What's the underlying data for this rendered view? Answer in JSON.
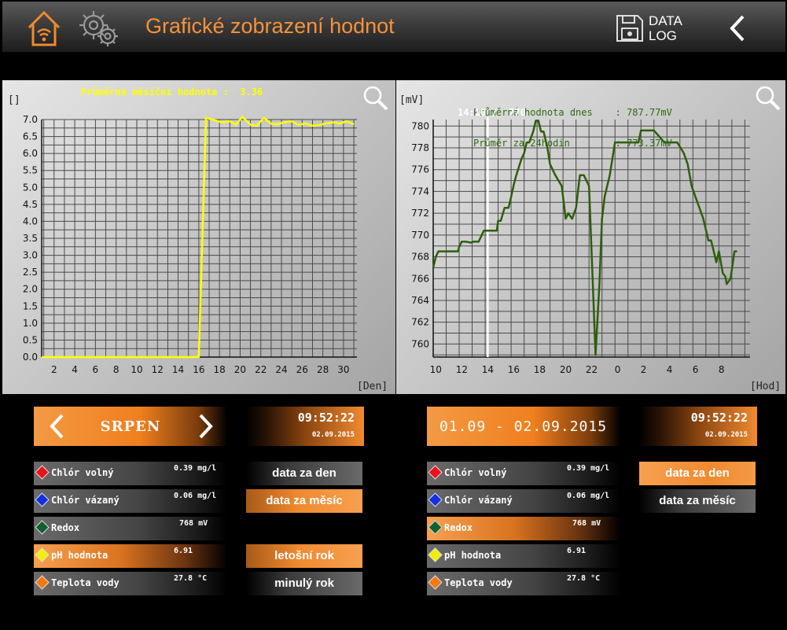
{
  "header": {
    "title": "Grafické zobrazení hodnot",
    "datalog_line1": "DATA",
    "datalog_line2": "LOG",
    "icons": [
      "home-wifi-icon",
      "gear-icon",
      "floppy-disk-icon",
      "back-arrow-icon"
    ]
  },
  "left_panel": {
    "unit": "[]",
    "x_unit": "[Den]",
    "info": "Průměrná měsíční hodnota :  3.36",
    "info_color": "#ffff00"
  },
  "right_panel": {
    "unit": "[mV]",
    "x_unit": "[Hod]",
    "info_line1": "Průměrná hodnota dnes    : 787.77mV",
    "info_line2": "Průměr za 24hodin        : 773.37mV",
    "info_color": "#2e6a10",
    "cursor_label": "14:10 /  770"
  },
  "chart_data": [
    {
      "type": "line",
      "xlabel": "[Den]",
      "ylabel": "[]",
      "ylim": [
        0,
        7
      ],
      "xlim": [
        0.8,
        31.3
      ],
      "xticks": [
        2,
        4,
        6,
        8,
        10,
        12,
        14,
        16,
        18,
        20,
        22,
        24,
        26,
        28,
        30
      ],
      "yticks": [
        "0.0",
        "0.5",
        "1.0",
        "1.5",
        "2.0",
        "2.5",
        "3.0",
        "3.5",
        "4.0",
        "4.5",
        "5.0",
        "5.5",
        "6.0",
        "6.5",
        "7.0"
      ],
      "grid": true,
      "color": "#ffff00",
      "x": [
        0.8,
        16.0,
        16.7,
        17.3,
        18.2,
        19.0,
        19.6,
        20.2,
        21.0,
        21.6,
        22.3,
        23.0,
        23.6,
        24.3,
        25.0,
        25.6,
        26.3,
        27.0,
        27.6,
        28.3,
        29.0,
        29.6,
        30.3,
        31.0
      ],
      "y": [
        0.0,
        0.0,
        7.05,
        7.0,
        6.92,
        6.95,
        6.85,
        7.08,
        6.85,
        6.82,
        7.05,
        6.88,
        6.86,
        6.92,
        6.95,
        6.85,
        6.88,
        6.82,
        6.84,
        6.88,
        6.92,
        6.88,
        6.95,
        6.86
      ]
    },
    {
      "type": "line",
      "xlabel": "[Hod]",
      "ylabel": "[mV]",
      "ylim": [
        758.8,
        780.6
      ],
      "xlim": [
        0,
        24.4
      ],
      "xticks": [
        {
          "p": 0.2,
          "l": "10"
        },
        {
          "p": 2.2,
          "l": "12"
        },
        {
          "p": 4.2,
          "l": "14"
        },
        {
          "p": 6.2,
          "l": "16"
        },
        {
          "p": 8.2,
          "l": "18"
        },
        {
          "p": 10.2,
          "l": "20"
        },
        {
          "p": 12.2,
          "l": "22"
        },
        {
          "p": 14.2,
          "l": "0"
        },
        {
          "p": 16.2,
          "l": "2"
        },
        {
          "p": 18.2,
          "l": "4"
        },
        {
          "p": 20.2,
          "l": "6"
        },
        {
          "p": 22.2,
          "l": "8"
        }
      ],
      "yticks": [
        760,
        762,
        764,
        766,
        768,
        770,
        772,
        774,
        776,
        778,
        780
      ],
      "grid": true,
      "color": "#2e5e0c",
      "cursor_x": 4.2,
      "x": [
        0.0,
        0.2,
        0.4,
        1.0,
        1.9,
        2.0,
        2.2,
        2.5,
        2.9,
        3.1,
        3.5,
        3.9,
        4.0,
        4.9,
        5.0,
        5.2,
        5.5,
        5.8,
        6.0,
        6.2,
        6.4,
        6.8,
        7.0,
        7.2,
        7.4,
        7.7,
        7.9,
        8.1,
        8.3,
        8.5,
        8.8,
        9.0,
        9.4,
        9.9,
        10.2,
        10.4,
        10.7,
        11.0,
        11.3,
        11.6,
        12.0,
        12.5,
        12.8,
        13.0,
        13.2,
        13.6,
        14.0,
        14.5,
        14.8,
        15.0,
        15.8,
        16.0,
        16.4,
        17.0,
        17.8,
        18.0,
        18.8,
        19.3,
        19.6,
        19.9,
        20.2,
        20.5,
        20.8,
        21.0,
        21.2,
        21.4,
        21.6,
        21.8,
        22.0,
        22.3,
        22.5,
        22.6,
        22.9,
        23.2,
        23.4
      ],
      "y": [
        767.0,
        768.0,
        768.5,
        768.5,
        768.5,
        768.9,
        769.4,
        769.4,
        769.3,
        769.4,
        769.4,
        770.4,
        770.4,
        770.4,
        771.3,
        771.3,
        772.5,
        772.5,
        773.5,
        774.6,
        775.5,
        777.0,
        777.5,
        778.5,
        778.5,
        779.5,
        780.5,
        780.5,
        779.5,
        779.5,
        778.0,
        776.5,
        775.5,
        774.5,
        771.5,
        772.0,
        771.5,
        772.5,
        775.5,
        775.5,
        774.5,
        759.0,
        765.5,
        771.5,
        773.5,
        775.5,
        778.5,
        778.5,
        778.5,
        778.5,
        778.5,
        779.6,
        779.6,
        779.6,
        778.5,
        778.5,
        778.5,
        777.5,
        776.5,
        774.5,
        773.5,
        772.5,
        771.5,
        770.5,
        769.5,
        769.5,
        768.5,
        767.5,
        768.5,
        766.5,
        766.2,
        765.5,
        766.0,
        768.5,
        768.5
      ]
    }
  ],
  "left_controls": {
    "month": "SRPEN",
    "time": "09:52:22",
    "date": "02.09.2015",
    "buttons": [
      "data za den",
      "data za měsíc",
      "letošní rok",
      "minulý rok"
    ]
  },
  "right_controls": {
    "range": "01.09 - 02.09.2015",
    "time": "09:52:22",
    "date": "02.09.2015",
    "buttons": [
      "data za den",
      "data za měsíc"
    ]
  },
  "sensors": [
    {
      "name": "Chlór volný",
      "value": "0.39 mg/l",
      "color": "#e8141a"
    },
    {
      "name": "Chlór vázaný",
      "value": "0.06 mg/l",
      "color": "#1230e0"
    },
    {
      "name": "Redox",
      "value": "768 mV",
      "color": "#126030"
    },
    {
      "name": "pH hodnota",
      "value": "6.91",
      "color": "#f0f000"
    },
    {
      "name": "Teplota vody",
      "value": "27.8 °C",
      "color": "#f07a14"
    }
  ]
}
